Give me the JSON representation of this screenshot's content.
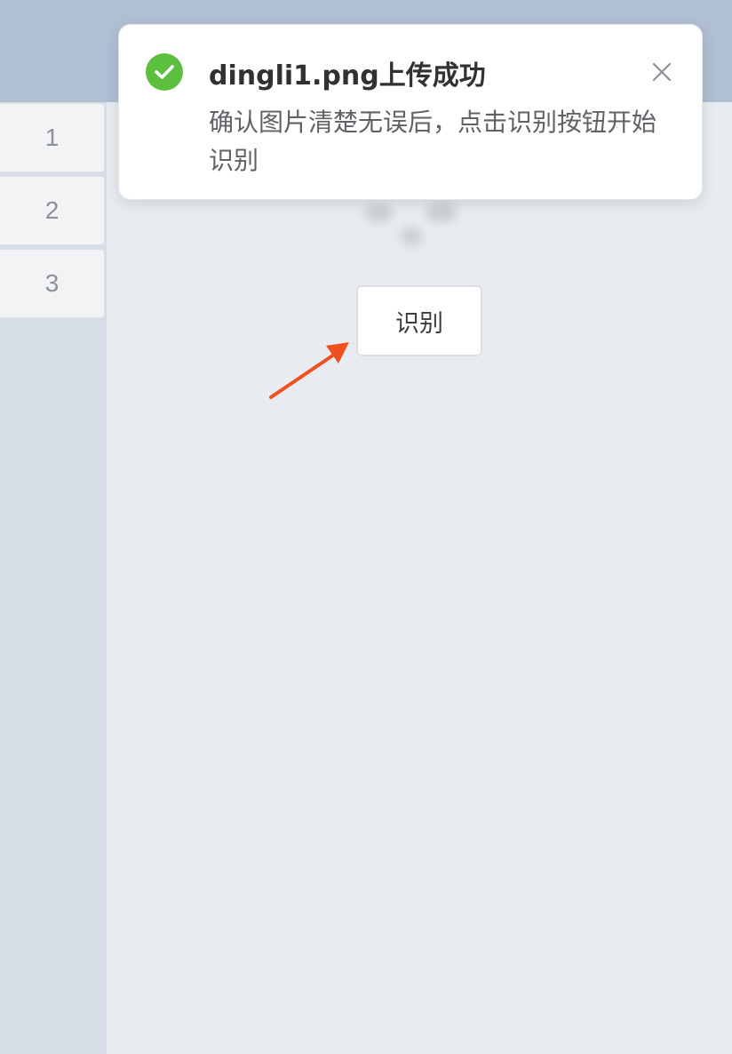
{
  "sidebar": {
    "tabs": [
      {
        "label": "1"
      },
      {
        "label": "2"
      },
      {
        "label": "3"
      }
    ]
  },
  "main": {
    "recognize_button_label": "识别"
  },
  "notification": {
    "title": "dingli1.png上传成功",
    "message": "确认图片清楚无误后，点击识别按钮开始识别",
    "status_icon": "check-circle-icon",
    "close_icon": "close-icon"
  },
  "colors": {
    "success": "#5cbf3f",
    "arrow": "#f0501e",
    "topbar": "#b1bfd3",
    "sidebar": "#d6dde7",
    "content_bg": "#e8ecf1"
  }
}
